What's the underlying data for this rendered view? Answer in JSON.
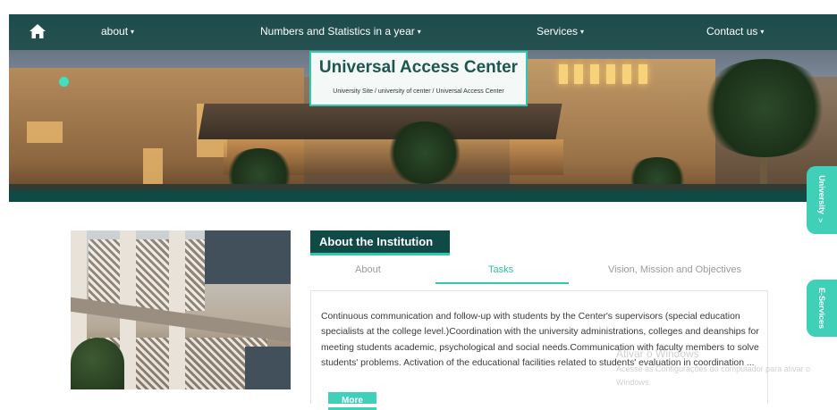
{
  "nav": {
    "home_icon": "home-icon",
    "items": [
      {
        "label": "about"
      },
      {
        "label": "Numbers and Statistics in a year"
      },
      {
        "label": "Services"
      },
      {
        "label": "Contact us"
      }
    ],
    "caret": "▾"
  },
  "hero": {
    "title": "Universal Access Center",
    "breadcrumb": "University Site / university of center / Universal Access Center"
  },
  "institution": {
    "header": "About the Institution",
    "tabs": [
      {
        "label": "About",
        "active": false
      },
      {
        "label": "Tasks",
        "active": true
      },
      {
        "label": "Vision, Mission and Objectives",
        "active": false
      }
    ],
    "content": "Continuous communication and follow-up with students by the Center's supervisors (special education specialists at the college level.)Coordination with the university administrations, colleges and deanships for meeting students academic, psychological and social needs.Communication with faculty members to solve students' problems. Activation of the educational facilities related to students' evaluation in coordination ...",
    "more_label": "More"
  },
  "side_tabs": [
    {
      "label": "University"
    },
    {
      "label": "E-Services"
    }
  ],
  "watermark": {
    "title": "Ativar o Windows",
    "subtitle": "Acesse as Configurações do computador para ativar o Windows."
  },
  "colors": {
    "nav_bg": "#124642",
    "accent": "#2fc9b0",
    "dark_teal": "#0f4a46",
    "button": "#3fd0b7"
  }
}
